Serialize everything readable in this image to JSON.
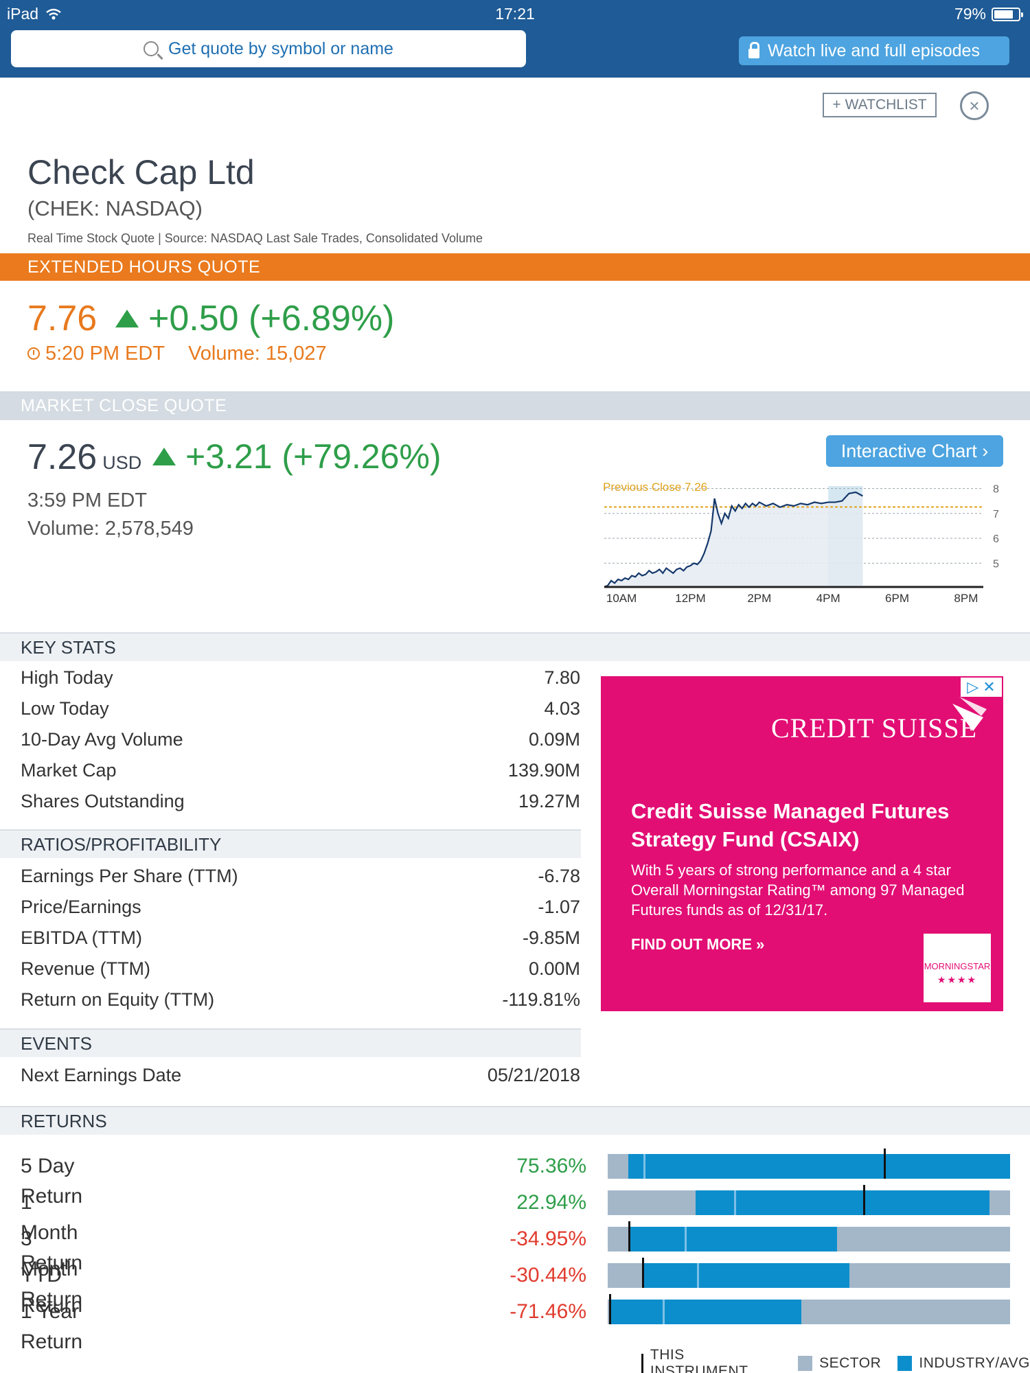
{
  "status_bar": {
    "device": "iPad",
    "time": "17:21",
    "battery": "79%",
    "battery_level": 0.79
  },
  "search": {
    "placeholder": "Get quote by symbol or name"
  },
  "promo": {
    "label": "Watch live and full episodes"
  },
  "actions": {
    "watchlist_label": "WATCHLIST",
    "plus": "+",
    "close": "×"
  },
  "company": {
    "name": "Check Cap Ltd",
    "ticker": "(CHEK: NASDAQ)",
    "source": "Real Time Stock Quote | Source: NASDAQ Last Sale Trades, Consolidated Volume"
  },
  "extended": {
    "banner": "EXTENDED HOURS QUOTE",
    "price": "7.76",
    "change": "+0.50 (+6.89%)",
    "time": "5:20 PM EDT",
    "volume": "Volume: 15,027"
  },
  "market_close": {
    "banner": "MARKET CLOSE QUOTE",
    "price": "7.26",
    "currency": "USD",
    "change": "+3.21 (+79.26%)",
    "time": "3:59 PM EDT",
    "volume": "Volume: 2,578,549",
    "chart_button": "Interactive Chart ›"
  },
  "chart_data": {
    "type": "line",
    "annotation": "Previous Close 7.26",
    "previous_close": 7.26,
    "ylim": [
      4.1,
      8.1
    ],
    "y_ticks": [
      "8",
      "7",
      "6",
      "5"
    ],
    "x_ticks": [
      "10AM",
      "12PM",
      "2PM",
      "4PM",
      "6PM",
      "8PM"
    ],
    "x_tick_hours": [
      10,
      12,
      14,
      16,
      18,
      20
    ],
    "xlim": [
      9.5,
      20.5
    ],
    "shaded_after_hours": [
      16,
      17
    ],
    "x": [
      9.5,
      9.6,
      9.7,
      9.8,
      9.9,
      10.0,
      10.1,
      10.2,
      10.3,
      10.4,
      10.5,
      10.6,
      10.7,
      10.8,
      10.9,
      11.0,
      11.1,
      11.2,
      11.3,
      11.4,
      11.5,
      11.6,
      11.7,
      11.8,
      11.9,
      12.0,
      12.1,
      12.2,
      12.3,
      12.4,
      12.5,
      12.6,
      12.7,
      12.8,
      12.9,
      13.0,
      13.1,
      13.2,
      13.3,
      13.4,
      13.5,
      13.6,
      13.7,
      13.8,
      13.9,
      14.0,
      14.2,
      14.4,
      14.6,
      14.8,
      15.0,
      15.2,
      15.4,
      15.6,
      15.8,
      16.0,
      16.2,
      16.4,
      16.6,
      16.8,
      17.0
    ],
    "y": [
      4.05,
      4.1,
      4.3,
      4.2,
      4.35,
      4.3,
      4.4,
      4.35,
      4.5,
      4.45,
      4.6,
      4.5,
      4.55,
      4.7,
      4.6,
      4.65,
      4.75,
      4.6,
      4.8,
      4.7,
      4.6,
      4.75,
      4.8,
      4.7,
      4.85,
      4.9,
      5.0,
      4.95,
      5.1,
      5.4,
      5.8,
      6.3,
      7.6,
      7.0,
      6.6,
      7.0,
      6.8,
      7.3,
      7.1,
      7.35,
      7.2,
      7.4,
      7.25,
      7.4,
      7.3,
      7.45,
      7.3,
      7.4,
      7.25,
      7.35,
      7.3,
      7.4,
      7.35,
      7.45,
      7.4,
      7.45,
      7.45,
      7.5,
      7.8,
      7.85,
      7.7
    ]
  },
  "key_stats": {
    "title": "KEY STATS",
    "rows": [
      {
        "label": "High Today",
        "value": "7.80"
      },
      {
        "label": "Low Today",
        "value": "4.03"
      },
      {
        "label": "10-Day Avg Volume",
        "value": "0.09M"
      },
      {
        "label": "Market Cap",
        "value": "139.90M"
      },
      {
        "label": "Shares Outstanding",
        "value": "19.27M"
      }
    ]
  },
  "ratios": {
    "title": "RATIOS/PROFITABILITY",
    "rows": [
      {
        "label": "Earnings Per Share (TTM)",
        "value": "-6.78"
      },
      {
        "label": "Price/Earnings",
        "value": "-1.07"
      },
      {
        "label": "EBITDA (TTM)",
        "value": "-9.85M"
      },
      {
        "label": "Revenue (TTM)",
        "value": "0.00M"
      },
      {
        "label": "Return on Equity (TTM)",
        "value": "-119.81%"
      }
    ]
  },
  "events": {
    "title": "EVENTS",
    "rows": [
      {
        "label": "Next Earnings Date",
        "value": "05/21/2018"
      }
    ]
  },
  "ad": {
    "brand": "CREDIT SUISSE",
    "headline": "Credit Suisse Managed Futures Strategy Fund (CSAIX)",
    "body": "With 5 years of strong performance and a 4 star Overall Morningstar Rating™ among 97 Managed Futures funds as of 12/31/17.",
    "cta": "FIND OUT MORE »",
    "rating_label": "MORNINGSTAR",
    "rating_stars": "★★★★",
    "adchoice": "▷ ✕"
  },
  "returns": {
    "title": "RETURNS",
    "rows": [
      {
        "label": "5 Day Return",
        "value": "75.36%",
        "color": "#2e9e49"
      },
      {
        "label": "1 Month Return",
        "value": "22.94%",
        "color": "#2e9e49"
      },
      {
        "label": "3 Month Return",
        "value": "-34.95%",
        "color": "#e03b2e"
      },
      {
        "label": "YTD Return",
        "value": "-30.44%",
        "color": "#e03b2e"
      },
      {
        "label": "1 Year Return",
        "value": "-71.46%",
        "color": "#e03b2e"
      }
    ],
    "legend": {
      "instrument": "THIS INSTRUMENT",
      "sector": "SECTOR",
      "industry": "INDUSTRY/AVG"
    },
    "colors": {
      "sector": "#a3b7c9",
      "industry": "#0c8ecd"
    }
  }
}
